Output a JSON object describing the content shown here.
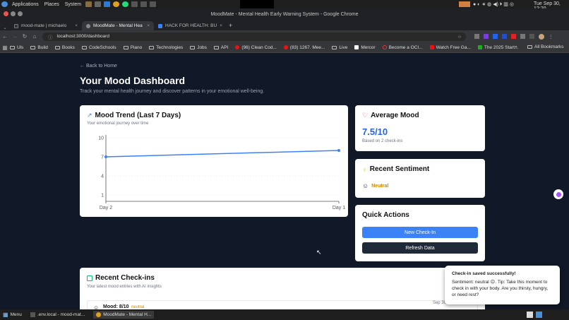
{
  "system": {
    "apps": "Applications",
    "places": "Places",
    "system": "System",
    "clock": "Tue Sep 30, 12:20"
  },
  "window": {
    "title": "MoodMate - Mental Health Early Warning System - Google Chrome"
  },
  "tabs": [
    {
      "label": "mood-mate | michaelo"
    },
    {
      "label": "MoodMate - Mental Hea"
    },
    {
      "label": "HACK FOR HEALTH: BU"
    }
  ],
  "address": {
    "url": "localhost:3000/dashboard"
  },
  "bookmarks": [
    "Uls",
    "Build",
    "Books",
    "CodeSchools",
    "Piano",
    "Technologies",
    "Jobs",
    "API",
    "(96) Clean Cod...",
    "(83) 1267. Mee...",
    "Live",
    "Mercor",
    "Become a OCI...",
    "Watch Free Ga...",
    "The 2025 Start..."
  ],
  "bookmarks_all": "All Bookmarks",
  "page": {
    "back": "Back to Home",
    "title": "Your Mood Dashboard",
    "subtitle": "Track your mental health journey and discover patterns in your emotional well-being."
  },
  "trend": {
    "title": "Mood Trend (Last 7 Days)",
    "subtitle": "Your emotional journey over time"
  },
  "chart_data": {
    "type": "line",
    "x": [
      "Day 2",
      "Day 1"
    ],
    "series": [
      {
        "values": [
          7,
          8
        ]
      }
    ],
    "ylim": [
      0,
      10
    ],
    "yticks": [
      "10",
      "7",
      "4",
      "1"
    ]
  },
  "average": {
    "title": "Average Mood",
    "value": "7.5/10",
    "note": "Based on 2 check-ins"
  },
  "sentiment": {
    "title": "Recent Sentiment",
    "value": "Neutral"
  },
  "actions": {
    "title": "Quick Actions",
    "new": "New Check-In",
    "refresh": "Refresh Data"
  },
  "recent": {
    "title": "Recent Check-ins",
    "subtitle": "Your latest mood entries with AI insights",
    "entry_mood": "Mood: 8/10",
    "entry_tag": "neutral",
    "entry_date": "Sep 30 at 12:20 PM"
  },
  "toast": {
    "title": "Check-in saved successfully!",
    "body": "Sentiment: neutral ☹. Tip: Take this moment to check in with your body. Are you thirsty, hungry, or need rest?"
  },
  "taskbar": {
    "menu": "Menu",
    "item1": ".env.local - mood-mat...",
    "item2": "MoodMate - Mental H..."
  },
  "colors": {
    "accent": "#3b82f6",
    "heart": "#ef4444",
    "neutral": "#ca8a04",
    "green": "#10b981"
  }
}
